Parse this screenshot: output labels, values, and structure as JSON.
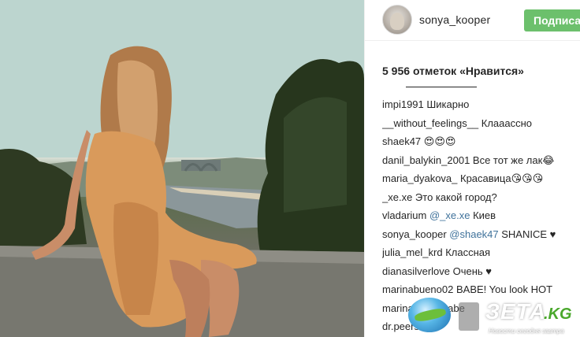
{
  "post": {
    "image_alt": "woman in orange dress sitting on stone wall above river"
  },
  "header": {
    "username": "sonya_kooper",
    "follow_label": "Подписаться",
    "avatar_icon": "avatar-photo"
  },
  "likes": {
    "count": "5 956",
    "label": "отметок «Нравится»"
  },
  "comments": [
    {
      "user": "impi1991",
      "text": " Шикарно"
    },
    {
      "user": "__without_feelings__",
      "text": " Клааассно"
    },
    {
      "user": "shaek47",
      "text": " 😍😍😍"
    },
    {
      "user": "danil_balykin_2001",
      "text": " Все тот же лак😂"
    },
    {
      "user": "maria_dyakova_",
      "text": " Красавица😘😘😘"
    },
    {
      "user": "_xe.xe",
      "text": " Это какой город?"
    },
    {
      "user": "vladarium",
      "mention": " @_xe.xe",
      "text": " Киев"
    },
    {
      "user": "sonya_kooper",
      "mention": " @shaek47",
      "text": " SHANICE ♥"
    },
    {
      "user": "julia_mel_krd",
      "text": " Классная"
    },
    {
      "user": "dianasilverlove",
      "text": " Очень ♥"
    },
    {
      "user": "marinabueno02",
      "text": " BABE! You look HOT"
    },
    {
      "user": "marina",
      "text": "...abe babe"
    },
    {
      "user": "dr.peerson",
      "text": ""
    }
  ],
  "watermark": {
    "brand": "ЗЕТА",
    "tld": ".KG",
    "tagline": "Новости сегодня завтра"
  },
  "colors": {
    "follow_button": "#6cc06c",
    "mention": "#3f729b",
    "text": "#262626"
  }
}
